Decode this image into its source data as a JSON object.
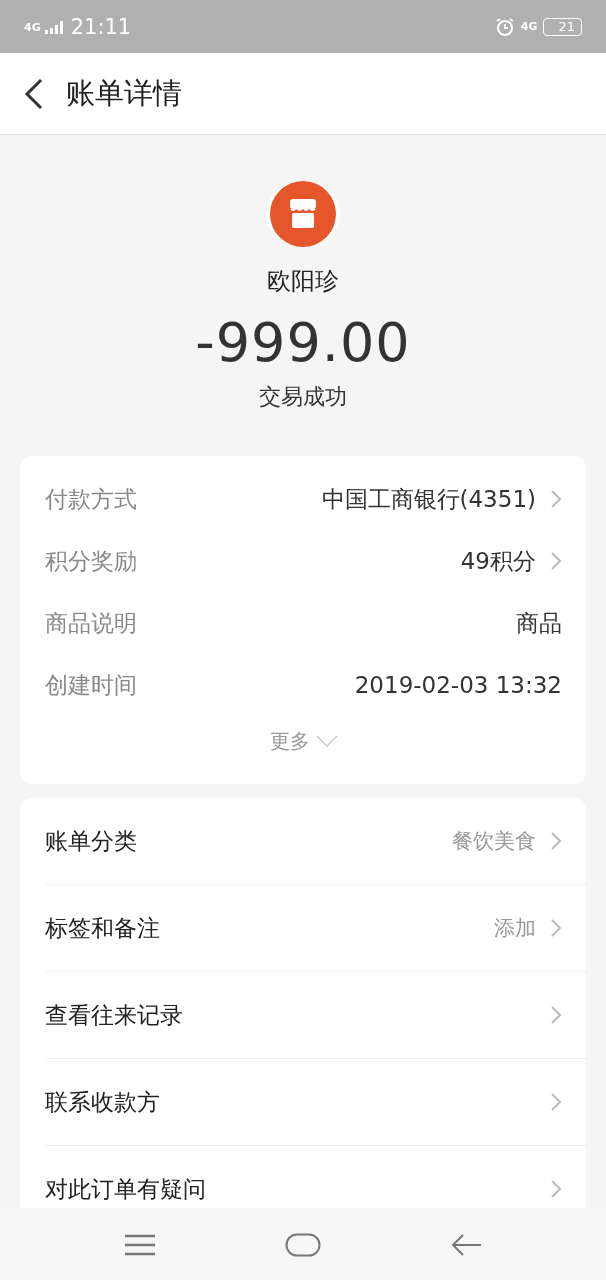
{
  "status_bar": {
    "network": "4G",
    "time": "21:11",
    "network_right": "4G",
    "battery": "21"
  },
  "header": {
    "title": "账单详情"
  },
  "merchant": {
    "name": "欧阳珍",
    "amount": "-999.00",
    "status": "交易成功"
  },
  "details": [
    {
      "label": "付款方式",
      "value": "中国工商银行(4351)",
      "arrow": true
    },
    {
      "label": "积分奖励",
      "value": "49积分",
      "arrow": true
    },
    {
      "label": "商品说明",
      "value": "商品",
      "arrow": false
    },
    {
      "label": "创建时间",
      "value": "2019-02-03 13:32",
      "arrow": false
    }
  ],
  "more": "更多",
  "actions": [
    {
      "label": "账单分类",
      "value": "餐饮美食"
    },
    {
      "label": "标签和备注",
      "value": "添加"
    },
    {
      "label": "查看往来记录"
    },
    {
      "label": "联系收款方"
    },
    {
      "label": "对此订单有疑问"
    }
  ]
}
